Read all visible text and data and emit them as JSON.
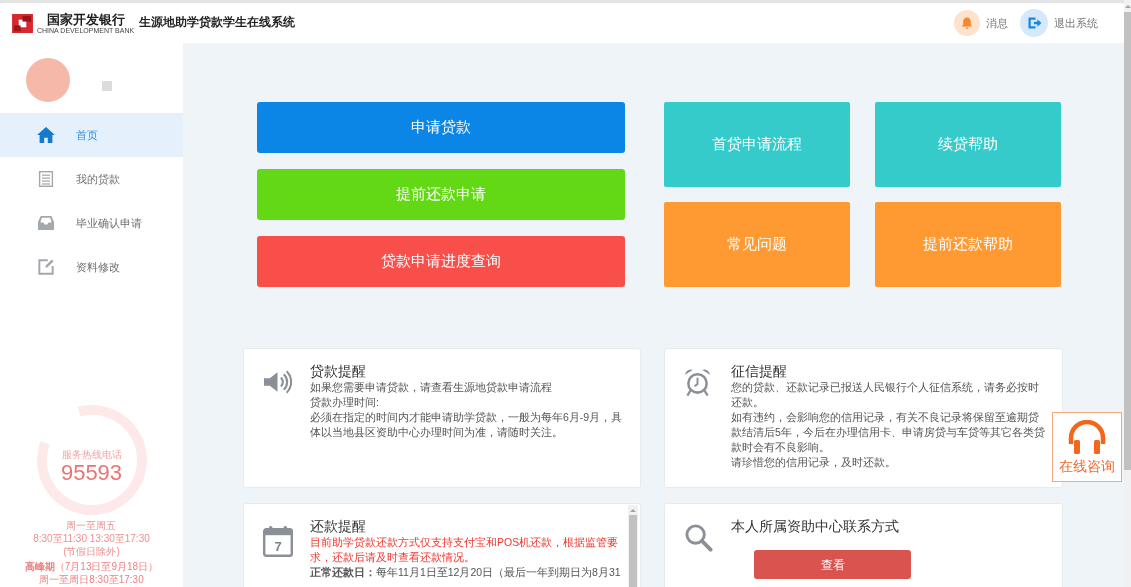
{
  "header": {
    "bank_name": "国家开发银行",
    "bank_name_en": "CHINA DEVELOPMENT BANK",
    "system_title": "生源地助学贷款学生在线系统",
    "actions": [
      {
        "label": "消息"
      },
      {
        "label": "退出系统"
      }
    ]
  },
  "sidebar": {
    "items": [
      {
        "label": "首页",
        "selected": true
      },
      {
        "label": "我的贷款",
        "selected": false
      },
      {
        "label": "毕业确认申请",
        "selected": false
      },
      {
        "label": "资料修改",
        "selected": false
      }
    ],
    "hotline": {
      "title": "服务热线电话",
      "number": "95593",
      "schedule": [
        "周一至周五",
        "8:30至11:30 13:30至17:30",
        "(节假日除外)"
      ],
      "peak": [
        "**高峰期**（7月13日至9月18日）",
        "周一至周日8:30至17:30"
      ]
    }
  },
  "quick_actions": [
    {
      "label": "申请贷款",
      "color": "#0b86e6"
    },
    {
      "label": "提前还款申请",
      "color": "#63d915"
    },
    {
      "label": "贷款申请进度查询",
      "color": "#f84f4b"
    }
  ],
  "help_tiles": [
    {
      "label": "首贷申请流程",
      "color": "#35cbcb"
    },
    {
      "label": "续贷帮助",
      "color": "#35cbcb"
    },
    {
      "label": "常见问题",
      "color": "#ff9a33"
    },
    {
      "label": "提前还款帮助",
      "color": "#ff9a33"
    }
  ],
  "notices": [
    {
      "title": "贷款提醒",
      "scrollable": false,
      "lines": [
        {
          "kind": "normal",
          "text": "如果您需要申请贷款，请查看生源地贷款申请流程"
        },
        {
          "kind": "normal",
          "text": "贷款办理时间:"
        },
        {
          "kind": "normal",
          "text": "必须在指定的时间内才能申请助学贷款，一般为每年6月-9月，具体以当地县区资助中心办理时间为准，请随时关注。"
        }
      ]
    },
    {
      "title": "征信提醒",
      "scrollable": false,
      "lines": [
        {
          "kind": "normal",
          "text": "您的贷款、还款记录已报送人民银行个人征信系统，请务必按时还款。"
        },
        {
          "kind": "normal",
          "text": "如有违约，会影响您的信用记录，有关不良记录将保留至逾期贷款结清后5年，今后在办理信用卡、申请房贷与车贷等其它各类贷款时会有不良影响。"
        },
        {
          "kind": "normal",
          "text": "请珍惜您的信用记录，及时还款。"
        }
      ]
    },
    {
      "title": "还款提醒",
      "calendar_day": "7",
      "scrollable": true,
      "lines": [
        {
          "kind": "warning",
          "text": "目前助学贷款还款方式仅支持支付宝和POS机还款，根据监管要求，还款后请及时查看还款情况。"
        },
        {
          "kind": "normal",
          "text": "**正常还款日：**每年11月1日至12月20日（最后一年到期日为8月31"
        }
      ]
    },
    {
      "title": "本人所属资助中心联系方式",
      "scrollable": false,
      "button": "查看"
    }
  ],
  "online_consult": {
    "label": "在线咨询"
  }
}
